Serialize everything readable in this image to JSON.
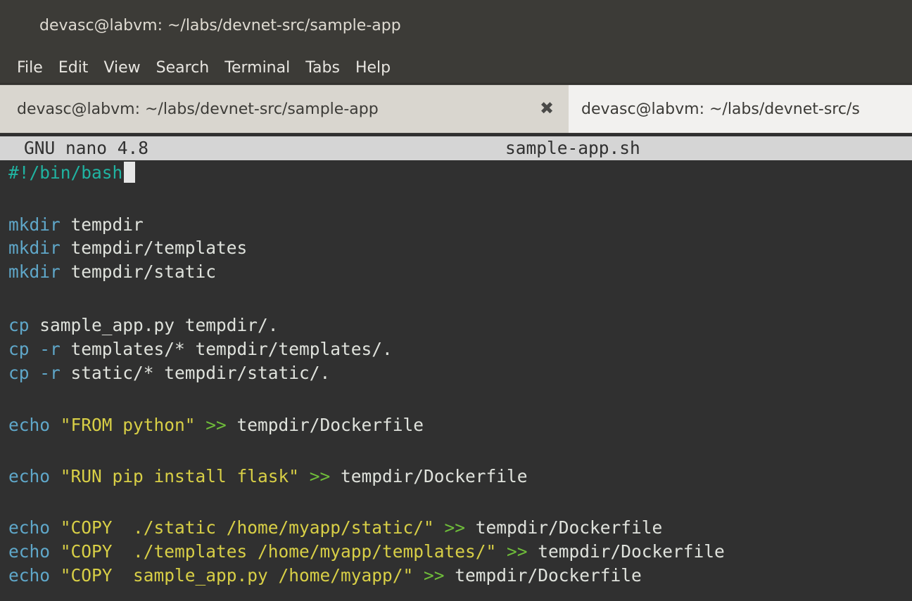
{
  "window": {
    "title": "devasc@labvm: ~/labs/devnet-src/sample-app"
  },
  "menu": [
    "File",
    "Edit",
    "View",
    "Search",
    "Terminal",
    "Tabs",
    "Help"
  ],
  "tabs": [
    {
      "label": "devasc@labvm: ~/labs/devnet-src/sample-app"
    },
    {
      "label": "devasc@labvm: ~/labs/devnet-src/s"
    }
  ],
  "nano": {
    "version": "GNU nano 4.8",
    "filename": "sample-app.sh"
  },
  "code": [
    {
      "shebang": "#!/bin/bash"
    },
    {
      "cmd": "mkdir",
      "rest": " tempdir"
    },
    {
      "cmd": "mkdir",
      "rest": " tempdir/templates"
    },
    {
      "cmd": "mkdir",
      "rest": " tempdir/static"
    },
    {
      "cmd": "cp",
      "rest": " sample_app.py tempdir/."
    },
    {
      "cmd": "cp",
      "flag": " -r",
      "rest": " templates/* tempdir/templates/."
    },
    {
      "cmd": "cp",
      "flag": " -r",
      "rest": " static/* tempdir/static/."
    },
    {
      "cmd": "echo",
      "str": " \"FROM python\"",
      "redir": " >>",
      "rest": " tempdir/Dockerfile"
    },
    {
      "cmd": "echo",
      "str": " \"RUN pip install flask\"",
      "redir": " >>",
      "rest": " tempdir/Dockerfile"
    },
    {
      "cmd": "echo",
      "str": " \"COPY  ./static /home/myapp/static/\"",
      "redir": " >>",
      "rest": " tempdir/Dockerfile"
    },
    {
      "cmd": "echo",
      "str": " \"COPY  ./templates /home/myapp/templates/\"",
      "redir": " >>",
      "rest": " tempdir/Dockerfile"
    },
    {
      "cmd": "echo",
      "str": " \"COPY  sample_app.py /home/myapp/\"",
      "redir": " >>",
      "rest": " tempdir/Dockerfile"
    }
  ],
  "colors": {
    "command": "#5fa7c9",
    "string": "#d8cf46",
    "redirect": "#6fbd3a",
    "shebang": "#20b3a1",
    "background": "#303030"
  }
}
